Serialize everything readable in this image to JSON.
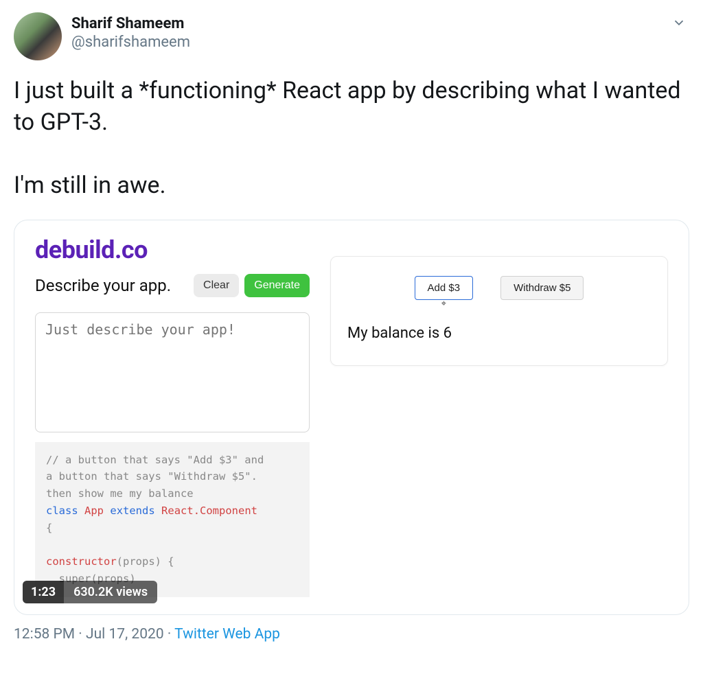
{
  "user": {
    "display_name": "Sharif Shameem",
    "handle": "@sharifshameem"
  },
  "tweet": {
    "line1": "I just built a *functioning* React app by describing what I wanted to GPT-3.",
    "line2": "I'm still in awe."
  },
  "media": {
    "brand": "debuild.co",
    "describe_label": "Describe your app.",
    "clear_label": "Clear",
    "generate_label": "Generate",
    "textarea_placeholder": "Just describe your app!",
    "code": {
      "comment_l1": "// a button that says \"Add $3\" and",
      "comment_l2": "a button that says \"Withdraw $5\".",
      "comment_l3": "then show me my balance",
      "kw_class": "class",
      "cls_name": "App",
      "kw_extends": "extends",
      "cls_type": "React.Component",
      "brace_open": "{",
      "ctor": "constructor",
      "ctor_args": "(props) {",
      "super_line": "super(props)"
    },
    "preview": {
      "add_label": "Add $3",
      "withdraw_label": "Withdraw $5",
      "balance_text": "My balance is 6"
    },
    "video": {
      "time": "1:23",
      "views": "630.2K views"
    }
  },
  "meta": {
    "time": "12:58 PM",
    "sep1": " · ",
    "date": "Jul 17, 2020",
    "sep2": " · ",
    "source": "Twitter Web App"
  }
}
